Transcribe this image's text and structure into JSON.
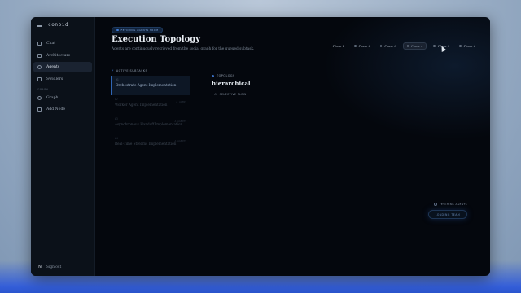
{
  "app": {
    "name": "conoid"
  },
  "sidebar": {
    "items": [
      {
        "label": "Chat",
        "icon": "chat-icon"
      },
      {
        "label": "Architecture",
        "icon": "architecture-icon"
      },
      {
        "label": "Agents",
        "icon": "agents-icon",
        "active": true
      },
      {
        "label": "Swidlers",
        "icon": "swidlers-icon"
      }
    ],
    "graph_section_label": "GRAPH",
    "graph_items": [
      {
        "label": "Graph",
        "icon": "graph-icon"
      },
      {
        "label": "Add Node",
        "icon": "add-node-icon"
      }
    ],
    "signout_label": "Sign out",
    "avatar_letter": "N"
  },
  "main": {
    "status_pill": "FETCHING AGENTS FROM",
    "title": "Execution Topology",
    "subtitle": "Agents are continuously retrieved from the social graph for the queued subtask.",
    "phases": [
      {
        "label": "Phase 1",
        "active": false
      },
      {
        "label": "Phase 2",
        "active": false
      },
      {
        "label": "Phase 3",
        "active": false
      },
      {
        "label": "Phase 4",
        "active": true
      },
      {
        "label": "Phase 5",
        "active": false
      },
      {
        "label": "Phase 6",
        "active": false
      }
    ],
    "subtasks_heading": "ACTIVE SUBTASKS",
    "tasks": [
      {
        "num": "#1",
        "name": "Orchestrate Agent Implementation",
        "meta": ""
      },
      {
        "num": "#2",
        "name": "Worker Agent Implementation",
        "meta": "A AGENT"
      },
      {
        "num": "#3",
        "name": "Asynchronous Handoff Implementation",
        "meta": "A AGENTS"
      },
      {
        "num": "#4",
        "name": "Real-Time Streams Implementation",
        "meta": "A AGENTS"
      }
    ],
    "topology_label": "TOPOLOGY",
    "topology_value": "hierarchical",
    "flow_label": "SELECTIVE FLOW",
    "fetching_label": "FETCHING AGENTS",
    "loading_label": "LOADING TEAM"
  },
  "colors": {
    "accent": "#3e7bd6",
    "background": "#04070d",
    "sidebar": "#0b1119"
  }
}
